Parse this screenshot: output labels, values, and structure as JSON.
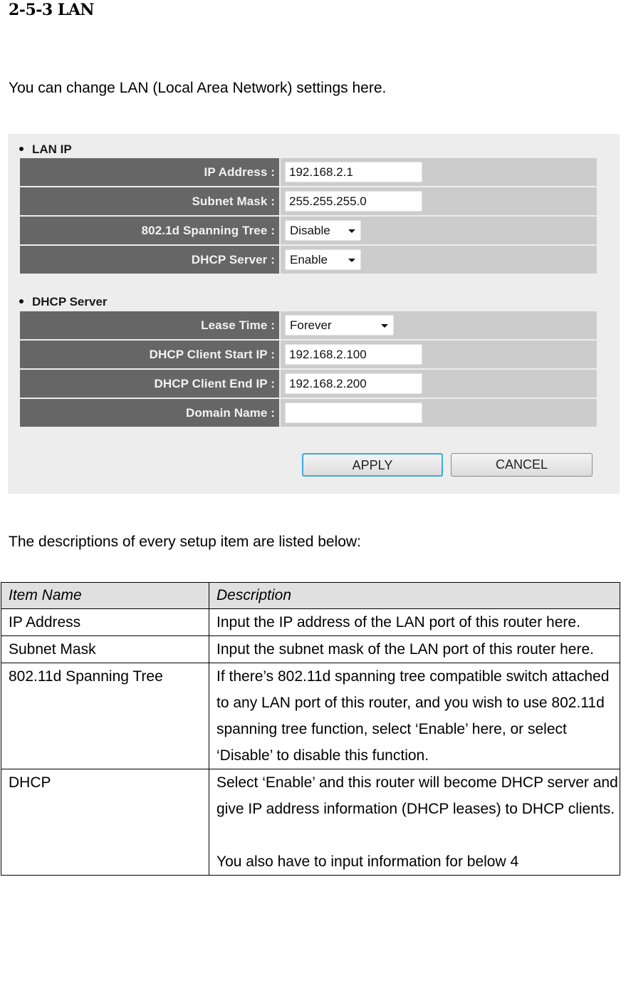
{
  "document": {
    "heading": "2-5-3 LAN",
    "intro": "You can change LAN (Local Area Network) settings here.",
    "descriptions_intro": "The descriptions of every setup item are listed below:"
  },
  "panel": {
    "colors": {
      "background": "#ededed",
      "label_cell": "#666666",
      "field_cell": "#cccccc",
      "apply_border": "#3fa9e0"
    },
    "lan_ip": {
      "title": "LAN IP",
      "rows": [
        {
          "label": "IP Address :",
          "type": "text",
          "value": "192.168.2.1"
        },
        {
          "label": "Subnet Mask :",
          "type": "text",
          "value": "255.255.255.0"
        },
        {
          "label": "802.1d Spanning Tree :",
          "type": "select",
          "value": "Disable"
        },
        {
          "label": "DHCP Server :",
          "type": "select",
          "value": "Enable"
        }
      ]
    },
    "dhcp_server": {
      "title": "DHCP Server",
      "rows": [
        {
          "label": "Lease Time :",
          "type": "select",
          "value": "Forever"
        },
        {
          "label": "DHCP Client Start IP :",
          "type": "text",
          "value": "192.168.2.100"
        },
        {
          "label": "DHCP Client End IP :",
          "type": "text",
          "value": "192.168.2.200"
        },
        {
          "label": "Domain Name :",
          "type": "text",
          "value": ""
        }
      ]
    },
    "buttons": {
      "apply": "APPLY",
      "cancel": "CANCEL"
    }
  },
  "table": {
    "headers": [
      "Item Name",
      "Description"
    ],
    "rows": [
      {
        "name": "IP Address",
        "description": [
          "Input the IP address of the LAN port of this router here."
        ]
      },
      {
        "name": "Subnet Mask",
        "description": [
          "Input the subnet mask of the LAN port of this router here."
        ]
      },
      {
        "name": "802.11d Spanning Tree",
        "description": [
          "If there’s 802.11d spanning tree compatible switch attached to any LAN port of this router, and you wish to use 802.11d spanning tree function, select ‘Enable’ here, or select ‘Disable’ to disable this function."
        ]
      },
      {
        "name": "DHCP",
        "description": [
          "Select ‘Enable’ and this router will become DHCP server and give IP address information (DHCP leases) to DHCP clients.",
          "You also have to input information for below 4"
        ]
      }
    ]
  }
}
